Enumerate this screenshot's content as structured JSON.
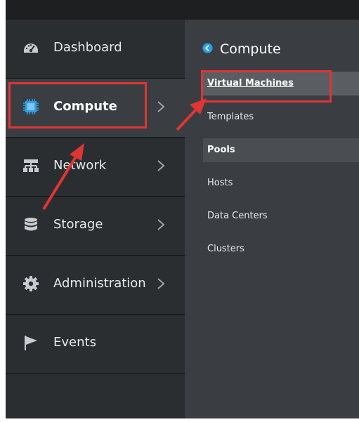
{
  "nav": {
    "items": [
      {
        "label": "Dashboard",
        "icon": "dashboard-icon",
        "has_chevron": false,
        "active": false
      },
      {
        "label": "Compute",
        "icon": "chip-icon",
        "has_chevron": true,
        "active": true
      },
      {
        "label": "Network",
        "icon": "network-icon",
        "has_chevron": true,
        "active": false
      },
      {
        "label": "Storage",
        "icon": "database-icon",
        "has_chevron": true,
        "active": false
      },
      {
        "label": "Administration",
        "icon": "gear-icon",
        "has_chevron": true,
        "active": false
      },
      {
        "label": "Events",
        "icon": "flag-icon",
        "has_chevron": false,
        "active": false
      }
    ]
  },
  "subpanel": {
    "title": "Compute",
    "items": [
      {
        "label": "Virtual Machines",
        "state": "selected"
      },
      {
        "label": "Templates",
        "state": "normal"
      },
      {
        "label": "Pools",
        "state": "hover"
      },
      {
        "label": "Hosts",
        "state": "normal"
      },
      {
        "label": "Data Centers",
        "state": "normal"
      },
      {
        "label": "Clusters",
        "state": "normal"
      }
    ]
  },
  "colors": {
    "accent": "#2e9fe6",
    "annotation": "#e13434"
  }
}
